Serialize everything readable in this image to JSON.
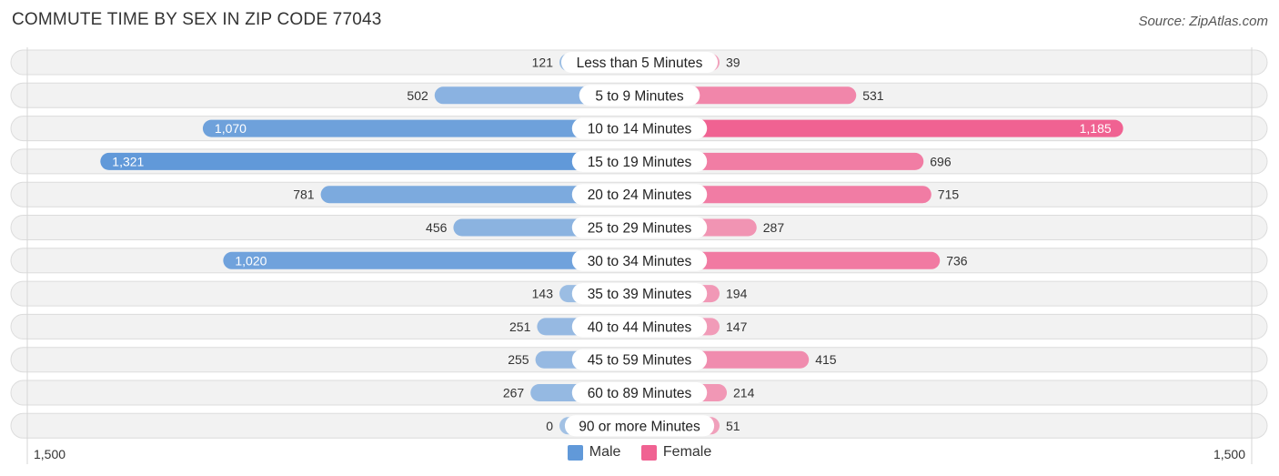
{
  "chart_data": {
    "type": "bar",
    "orientation": "horizontal-diverging",
    "title": "COMMUTE TIME BY SEX IN ZIP CODE 77043",
    "source": "Source: ZipAtlas.com",
    "categories": [
      "Less than 5 Minutes",
      "5 to 9 Minutes",
      "10 to 14 Minutes",
      "15 to 19 Minutes",
      "20 to 24 Minutes",
      "25 to 29 Minutes",
      "30 to 34 Minutes",
      "35 to 39 Minutes",
      "40 to 44 Minutes",
      "45 to 59 Minutes",
      "60 to 89 Minutes",
      "90 or more Minutes"
    ],
    "series": [
      {
        "name": "Male",
        "color": "#6199d9",
        "side": "left",
        "values": [
          121,
          502,
          1070,
          1321,
          781,
          456,
          1020,
          143,
          251,
          255,
          267,
          0
        ],
        "labels": [
          "121",
          "502",
          "1,070",
          "1,321",
          "781",
          "456",
          "1,020",
          "143",
          "251",
          "255",
          "267",
          "0"
        ]
      },
      {
        "name": "Female",
        "color": "#f06292",
        "side": "right",
        "values": [
          39,
          531,
          1185,
          696,
          715,
          287,
          736,
          194,
          147,
          415,
          214,
          51
        ],
        "labels": [
          "39",
          "531",
          "1,185",
          "696",
          "715",
          "287",
          "736",
          "194",
          "147",
          "415",
          "214",
          "51"
        ]
      }
    ],
    "axis": {
      "min": -1500,
      "max": 1500,
      "left_tick_label": "1,500",
      "right_tick_label": "1,500"
    },
    "legend": {
      "position": "bottom-center",
      "items": [
        "Male",
        "Female"
      ]
    },
    "grid": false
  }
}
